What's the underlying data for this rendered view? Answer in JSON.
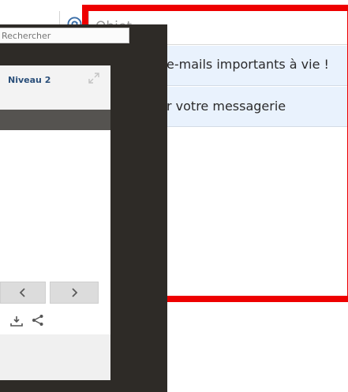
{
  "email_list": {
    "header": {
      "subject_label": "Objet"
    },
    "rows": [
      {
        "subject": "e-mails importants à vie !"
      },
      {
        "subject": "r votre messagerie"
      }
    ]
  },
  "overlay": {
    "search": {
      "placeholder": "Rechercher"
    },
    "card": {
      "title": "Niveau 2"
    }
  },
  "colors": {
    "highlight_frame": "#ee0000",
    "row_background": "#e9f2fd",
    "panel_background": "#2e2b27",
    "card_title": "#2a4f7a"
  },
  "icons": {
    "header": "at-icon",
    "card": "expand-icon",
    "prev": "chevron-left-icon",
    "next": "chevron-right-icon",
    "download": "download-icon",
    "share": "share-icon"
  }
}
